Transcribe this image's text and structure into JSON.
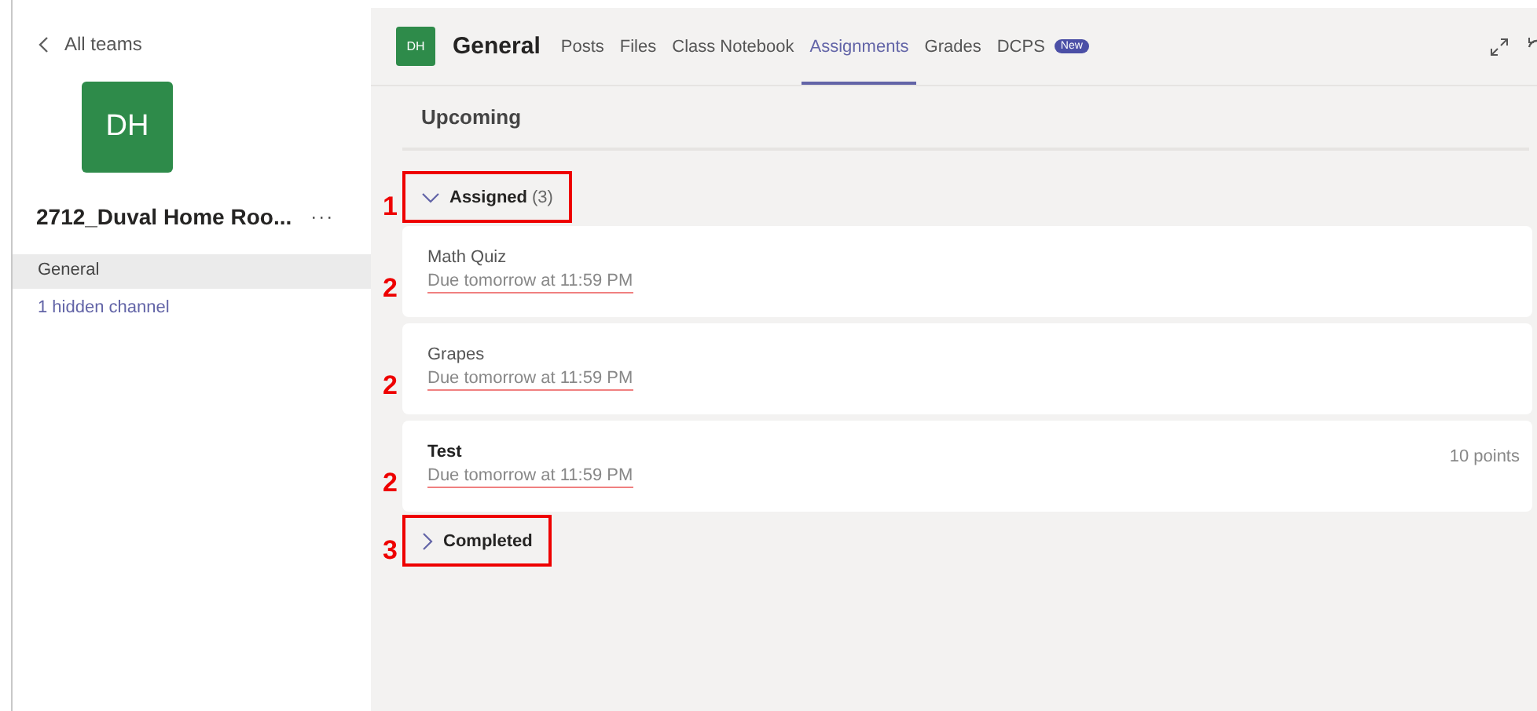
{
  "sidebar": {
    "back_link": "All teams",
    "team_avatar": "DH",
    "team_name": "2712_Duval Home Roo...",
    "more": "···",
    "channels": [
      {
        "label": "General",
        "selected": true
      },
      {
        "label": "1 hidden channel",
        "selected": false,
        "kind": "link"
      }
    ]
  },
  "header": {
    "avatar": "DH",
    "channel": "General",
    "tabs": [
      {
        "label": "Posts",
        "selected": false
      },
      {
        "label": "Files",
        "selected": false
      },
      {
        "label": "Class Notebook",
        "selected": false
      },
      {
        "label": "Assignments",
        "selected": true
      },
      {
        "label": "Grades",
        "selected": false
      },
      {
        "label": "DCPS",
        "selected": false,
        "badge": "New"
      }
    ]
  },
  "view_title": "Upcoming",
  "sections": [
    {
      "label": "Assigned",
      "count": "(3)",
      "expanded": true,
      "highlighted": true,
      "marker": "1",
      "items": [
        {
          "title": "Math Quiz",
          "due": "Due tomorrow at 11:59 PM",
          "emphasized": false,
          "underlined": true,
          "marker": "2"
        },
        {
          "title": "Grapes",
          "due": "Due tomorrow at 11:59 PM",
          "emphasized": false,
          "underlined": true,
          "marker": "2"
        },
        {
          "title": "Test",
          "due": "Due tomorrow at 11:59 PM",
          "points": "10 points",
          "emphasized": true,
          "underlined": true,
          "marker": "2"
        }
      ]
    },
    {
      "label": "Completed",
      "expanded": false,
      "highlighted": true,
      "marker": "3"
    }
  ]
}
